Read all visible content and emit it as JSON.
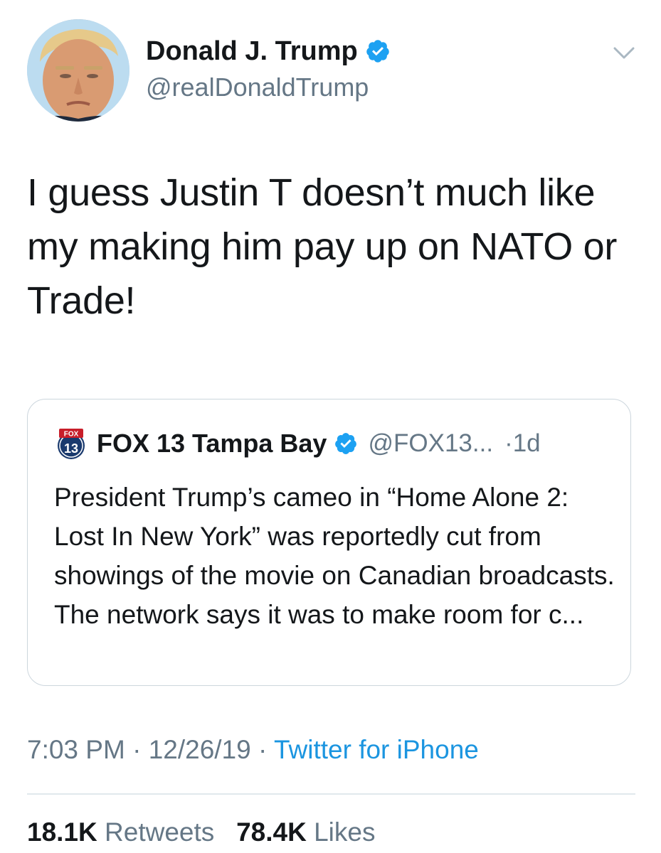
{
  "author": {
    "name": "Donald J. Trump",
    "handle": "@realDonaldTrump"
  },
  "tweet": {
    "text": "I guess Justin T doesn’t much like my making him pay up on NATO or Trade!"
  },
  "quoted_tweet": {
    "name": "FOX 13 Tampa Bay",
    "handle": "@FOX13...",
    "separator": "·",
    "time": "1d",
    "logo_text_top": "FOX",
    "logo_text_bottom": "13",
    "text": "President Trump’s cameo in “Home Alone 2: Lost In New York” was reportedly cut from showings of the movie on Canadian broadcasts. The network says it was to make room for c..."
  },
  "meta": {
    "time": "7:03 PM",
    "date": "12/26/19",
    "separator": "·",
    "source": "Twitter for iPhone"
  },
  "stats": {
    "retweets_count": "18.1K",
    "retweets_label": "Retweets",
    "likes_count": "78.4K",
    "likes_label": "Likes"
  },
  "colors": {
    "text": "#14171a",
    "secondary": "#657786",
    "link": "#1b95e0",
    "verified": "#1da1f2",
    "border": "#ccd6dd"
  },
  "icons": [
    "avatar",
    "verified-badge-icon",
    "chevron-down-icon",
    "fox13-logo-icon"
  ]
}
